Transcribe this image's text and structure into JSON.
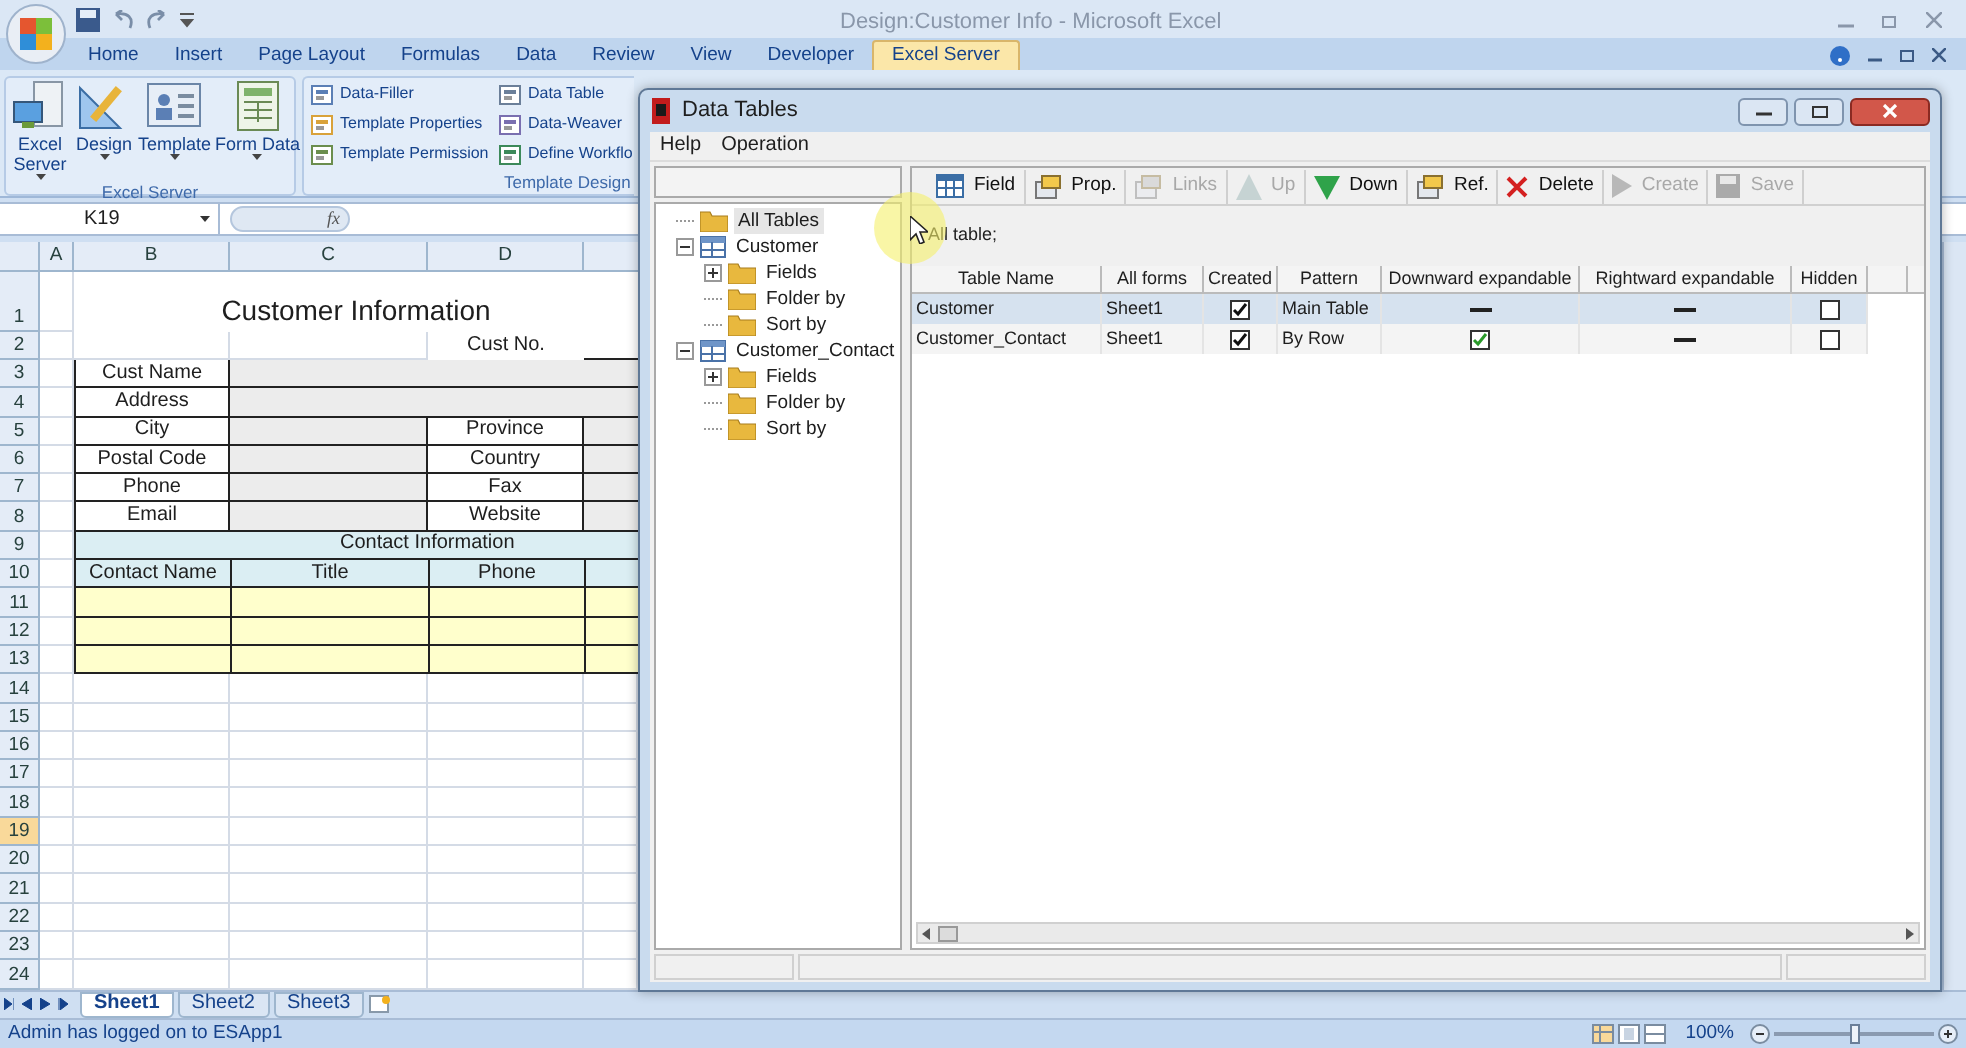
{
  "window": {
    "title": "Design:Customer Info - Microsoft Excel"
  },
  "ribbon_tabs": [
    {
      "label": "Home",
      "selected": false
    },
    {
      "label": "Insert",
      "selected": false
    },
    {
      "label": "Page Layout",
      "selected": false
    },
    {
      "label": "Formulas",
      "selected": false
    },
    {
      "label": "Data",
      "selected": false
    },
    {
      "label": "Review",
      "selected": false
    },
    {
      "label": "View",
      "selected": false
    },
    {
      "label": "Developer",
      "selected": false
    },
    {
      "label": "Excel Server",
      "selected": true
    }
  ],
  "ribbon_groups": [
    {
      "label": "Excel Server",
      "kind": "large",
      "buttons": [
        {
          "label": "Excel Server",
          "kind": "server"
        },
        {
          "label": "Design",
          "kind": "design"
        },
        {
          "label": "Template",
          "kind": "template"
        },
        {
          "label": "Form Data",
          "kind": "form"
        }
      ]
    },
    {
      "label": "Template Design",
      "kind": "small",
      "buttons": [
        {
          "label": "Data-Filler",
          "kind": "filler"
        },
        {
          "label": "Template Properties",
          "kind": "props"
        },
        {
          "label": "Template Permission",
          "kind": "permission"
        },
        {
          "label": "Data Table",
          "kind": "table"
        },
        {
          "label": "Data-Weaver",
          "kind": "weaver"
        },
        {
          "label": "Define Workflo",
          "kind": "workflow"
        }
      ]
    }
  ],
  "formula_bar": {
    "name_box": "K19",
    "function_label": "fx"
  },
  "sheet": {
    "columns": [
      "A",
      "B",
      "C",
      "D"
    ],
    "rows": [
      {
        "label": "1",
        "selected": false
      },
      {
        "label": "2",
        "selected": false
      },
      {
        "label": "3",
        "selected": false
      },
      {
        "label": "4",
        "selected": false
      },
      {
        "label": "5",
        "selected": false
      },
      {
        "label": "6",
        "selected": false
      },
      {
        "label": "7",
        "selected": false
      },
      {
        "label": "8",
        "selected": false
      },
      {
        "label": "9",
        "selected": false
      },
      {
        "label": "10",
        "selected": false
      },
      {
        "label": "11",
        "selected": false
      },
      {
        "label": "12",
        "selected": false
      },
      {
        "label": "13",
        "selected": false
      },
      {
        "label": "14",
        "selected": false
      },
      {
        "label": "15",
        "selected": false
      },
      {
        "label": "16",
        "selected": false
      },
      {
        "label": "17",
        "selected": false
      },
      {
        "label": "18",
        "selected": false
      },
      {
        "label": "19",
        "selected": true
      },
      {
        "label": "20",
        "selected": false
      },
      {
        "label": "21",
        "selected": false
      },
      {
        "label": "22",
        "selected": false
      },
      {
        "label": "23",
        "selected": false
      },
      {
        "label": "24",
        "selected": false
      }
    ],
    "title": "Customer Information",
    "cust_no_label": "Cust No.",
    "field_labels": [
      "Cust Name",
      "Address",
      "City",
      "Postal Code",
      "Phone",
      "Email"
    ],
    "side_labels": [
      "Province",
      "Country",
      "Fax",
      "Website"
    ],
    "contact_title": "Contact Information",
    "contact_columns": [
      "Contact Name",
      "Title",
      "Phone"
    ]
  },
  "sheet_tabs": [
    {
      "label": "Sheet1",
      "selected": true
    },
    {
      "label": "Sheet2",
      "selected": false
    },
    {
      "label": "Sheet3",
      "selected": false
    }
  ],
  "status_bar": {
    "message": "Admin has logged on to ESApp1",
    "zoom": "100%",
    "zoom_slider": {
      "level": 0.5
    }
  },
  "dialog": {
    "title": "Data Tables",
    "menu": [
      "Help",
      "Operation"
    ],
    "tree": [
      {
        "label": "All Tables",
        "kind": "folder",
        "selected": true
      },
      {
        "label": "Customer",
        "kind": "table",
        "selected": false,
        "expanded": true,
        "children": [
          {
            "label": "Fields",
            "kind": "folder",
            "selected": false,
            "expanded": false
          },
          {
            "label": "Folder by",
            "kind": "folder",
            "selected": false
          },
          {
            "label": "Sort by",
            "kind": "folder",
            "selected": false
          }
        ]
      },
      {
        "label": "Customer_Contact",
        "kind": "table",
        "selected": false,
        "expanded": true,
        "children": [
          {
            "label": "Fields",
            "kind": "folder",
            "selected": false,
            "expanded": false
          },
          {
            "label": "Folder by",
            "kind": "folder",
            "selected": false
          },
          {
            "label": "Sort by",
            "kind": "folder",
            "selected": false
          }
        ]
      }
    ],
    "toolbar": [
      {
        "label": "Field",
        "kind": "grid",
        "disabled": false
      },
      {
        "label": "Prop.",
        "kind": "props",
        "disabled": false
      },
      {
        "label": "Links",
        "kind": "links",
        "disabled": true
      },
      {
        "label": "Up",
        "kind": "up",
        "disabled": true
      },
      {
        "label": "Down",
        "kind": "down",
        "disabled": false
      },
      {
        "label": "Ref.",
        "kind": "ref",
        "disabled": false
      },
      {
        "label": "Delete",
        "kind": "delete",
        "disabled": false
      },
      {
        "label": "Create",
        "kind": "create",
        "disabled": true
      },
      {
        "label": "Save",
        "kind": "save",
        "disabled": true
      }
    ],
    "filter_label": "All table;",
    "table": {
      "columns": [
        "Table Name",
        "All forms",
        "Created",
        "Pattern",
        "Downward expandable",
        "Rightward expandable",
        "Hidden"
      ],
      "rows": [
        {
          "selected": true,
          "cells": [
            {
              "kind": "text",
              "text": "Customer"
            },
            {
              "kind": "text",
              "text": "Sheet1"
            },
            {
              "kind": "checkbox",
              "checked": true
            },
            {
              "kind": "text",
              "text": "Main Table"
            },
            {
              "kind": "dash"
            },
            {
              "kind": "dash"
            },
            {
              "kind": "checkbox",
              "checked": false
            }
          ]
        },
        {
          "selected": false,
          "cells": [
            {
              "kind": "text",
              "text": "Customer_Contact"
            },
            {
              "kind": "text",
              "text": "Sheet1"
            },
            {
              "kind": "checkbox",
              "checked": true
            },
            {
              "kind": "text",
              "text": "By Row"
            },
            {
              "kind": "tick",
              "checked": true
            },
            {
              "kind": "dash"
            },
            {
              "kind": "checkbox",
              "checked": false
            }
          ]
        }
      ]
    }
  }
}
